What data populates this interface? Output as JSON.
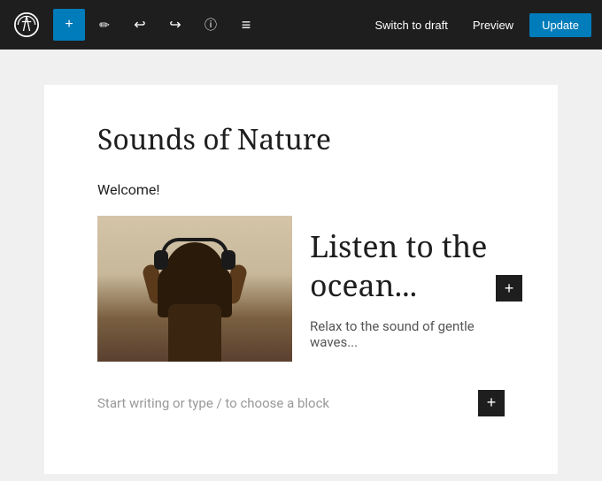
{
  "toolbar": {
    "add_label": "+",
    "switch_draft_label": "Switch to draft",
    "preview_label": "Preview",
    "update_label": "Update"
  },
  "editor": {
    "page_title": "Sounds of Nature",
    "welcome_text": "Welcome!",
    "ocean_heading": "Listen to the ocean...",
    "ocean_subtext": "Relax to the sound of gentle waves...",
    "placeholder": "Start writing or type / to choose a block"
  },
  "icons": {
    "add": "+",
    "pencil": "✏",
    "undo": "↩",
    "redo": "↪",
    "info": "ℹ",
    "menu": "≡"
  }
}
